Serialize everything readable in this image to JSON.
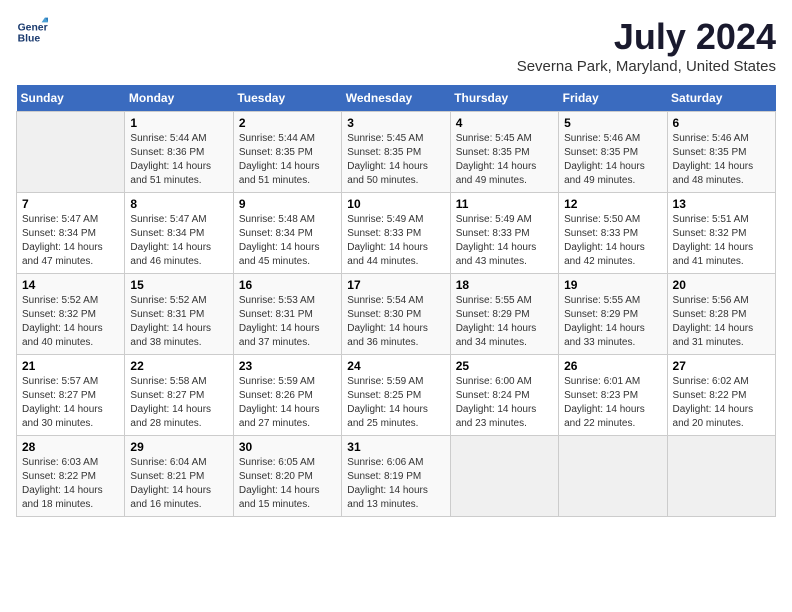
{
  "header": {
    "logo_line1": "General",
    "logo_line2": "Blue",
    "title": "July 2024",
    "subtitle": "Severna Park, Maryland, United States"
  },
  "weekdays": [
    "Sunday",
    "Monday",
    "Tuesday",
    "Wednesday",
    "Thursday",
    "Friday",
    "Saturday"
  ],
  "weeks": [
    [
      {
        "day": "",
        "info": ""
      },
      {
        "day": "1",
        "info": "Sunrise: 5:44 AM\nSunset: 8:36 PM\nDaylight: 14 hours\nand 51 minutes."
      },
      {
        "day": "2",
        "info": "Sunrise: 5:44 AM\nSunset: 8:35 PM\nDaylight: 14 hours\nand 51 minutes."
      },
      {
        "day": "3",
        "info": "Sunrise: 5:45 AM\nSunset: 8:35 PM\nDaylight: 14 hours\nand 50 minutes."
      },
      {
        "day": "4",
        "info": "Sunrise: 5:45 AM\nSunset: 8:35 PM\nDaylight: 14 hours\nand 49 minutes."
      },
      {
        "day": "5",
        "info": "Sunrise: 5:46 AM\nSunset: 8:35 PM\nDaylight: 14 hours\nand 49 minutes."
      },
      {
        "day": "6",
        "info": "Sunrise: 5:46 AM\nSunset: 8:35 PM\nDaylight: 14 hours\nand 48 minutes."
      }
    ],
    [
      {
        "day": "7",
        "info": "Sunrise: 5:47 AM\nSunset: 8:34 PM\nDaylight: 14 hours\nand 47 minutes."
      },
      {
        "day": "8",
        "info": "Sunrise: 5:47 AM\nSunset: 8:34 PM\nDaylight: 14 hours\nand 46 minutes."
      },
      {
        "day": "9",
        "info": "Sunrise: 5:48 AM\nSunset: 8:34 PM\nDaylight: 14 hours\nand 45 minutes."
      },
      {
        "day": "10",
        "info": "Sunrise: 5:49 AM\nSunset: 8:33 PM\nDaylight: 14 hours\nand 44 minutes."
      },
      {
        "day": "11",
        "info": "Sunrise: 5:49 AM\nSunset: 8:33 PM\nDaylight: 14 hours\nand 43 minutes."
      },
      {
        "day": "12",
        "info": "Sunrise: 5:50 AM\nSunset: 8:33 PM\nDaylight: 14 hours\nand 42 minutes."
      },
      {
        "day": "13",
        "info": "Sunrise: 5:51 AM\nSunset: 8:32 PM\nDaylight: 14 hours\nand 41 minutes."
      }
    ],
    [
      {
        "day": "14",
        "info": "Sunrise: 5:52 AM\nSunset: 8:32 PM\nDaylight: 14 hours\nand 40 minutes."
      },
      {
        "day": "15",
        "info": "Sunrise: 5:52 AM\nSunset: 8:31 PM\nDaylight: 14 hours\nand 38 minutes."
      },
      {
        "day": "16",
        "info": "Sunrise: 5:53 AM\nSunset: 8:31 PM\nDaylight: 14 hours\nand 37 minutes."
      },
      {
        "day": "17",
        "info": "Sunrise: 5:54 AM\nSunset: 8:30 PM\nDaylight: 14 hours\nand 36 minutes."
      },
      {
        "day": "18",
        "info": "Sunrise: 5:55 AM\nSunset: 8:29 PM\nDaylight: 14 hours\nand 34 minutes."
      },
      {
        "day": "19",
        "info": "Sunrise: 5:55 AM\nSunset: 8:29 PM\nDaylight: 14 hours\nand 33 minutes."
      },
      {
        "day": "20",
        "info": "Sunrise: 5:56 AM\nSunset: 8:28 PM\nDaylight: 14 hours\nand 31 minutes."
      }
    ],
    [
      {
        "day": "21",
        "info": "Sunrise: 5:57 AM\nSunset: 8:27 PM\nDaylight: 14 hours\nand 30 minutes."
      },
      {
        "day": "22",
        "info": "Sunrise: 5:58 AM\nSunset: 8:27 PM\nDaylight: 14 hours\nand 28 minutes."
      },
      {
        "day": "23",
        "info": "Sunrise: 5:59 AM\nSunset: 8:26 PM\nDaylight: 14 hours\nand 27 minutes."
      },
      {
        "day": "24",
        "info": "Sunrise: 5:59 AM\nSunset: 8:25 PM\nDaylight: 14 hours\nand 25 minutes."
      },
      {
        "day": "25",
        "info": "Sunrise: 6:00 AM\nSunset: 8:24 PM\nDaylight: 14 hours\nand 23 minutes."
      },
      {
        "day": "26",
        "info": "Sunrise: 6:01 AM\nSunset: 8:23 PM\nDaylight: 14 hours\nand 22 minutes."
      },
      {
        "day": "27",
        "info": "Sunrise: 6:02 AM\nSunset: 8:22 PM\nDaylight: 14 hours\nand 20 minutes."
      }
    ],
    [
      {
        "day": "28",
        "info": "Sunrise: 6:03 AM\nSunset: 8:22 PM\nDaylight: 14 hours\nand 18 minutes."
      },
      {
        "day": "29",
        "info": "Sunrise: 6:04 AM\nSunset: 8:21 PM\nDaylight: 14 hours\nand 16 minutes."
      },
      {
        "day": "30",
        "info": "Sunrise: 6:05 AM\nSunset: 8:20 PM\nDaylight: 14 hours\nand 15 minutes."
      },
      {
        "day": "31",
        "info": "Sunrise: 6:06 AM\nSunset: 8:19 PM\nDaylight: 14 hours\nand 13 minutes."
      },
      {
        "day": "",
        "info": ""
      },
      {
        "day": "",
        "info": ""
      },
      {
        "day": "",
        "info": ""
      }
    ]
  ]
}
